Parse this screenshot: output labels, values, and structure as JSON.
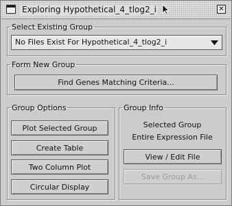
{
  "window": {
    "title": "Exploring Hypothetical_4_tlog2_i",
    "close_glyph": "✕"
  },
  "select_existing": {
    "legend": "Select Existing Group",
    "selected_value": "No Files Exist For Hypothetical_4_tlog2_i",
    "dropdown_icon": "chevron-down-icon"
  },
  "form_new": {
    "legend": "Form New Group",
    "find_genes_label": "Find Genes Matching Criteria..."
  },
  "group_options": {
    "legend": "Group Options",
    "buttons": [
      "Plot Selected Group",
      "Create Table",
      "Two Column Plot",
      "Circular Display"
    ]
  },
  "group_info": {
    "legend": "Group Info",
    "selected_group_label": "Selected Group",
    "selected_group_value": "Entire Expression File",
    "view_edit_label": "View / Edit File",
    "save_group_label": "Save Group As..."
  }
}
